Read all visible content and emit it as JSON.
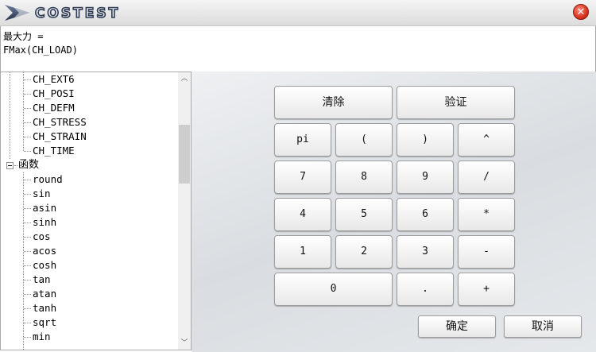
{
  "titlebar": {
    "logo_text": "COSTEST"
  },
  "formula": {
    "line1": "最大力 =",
    "line2": "FMax(CH_LOAD)"
  },
  "tree": {
    "channels": [
      "CH_EXT6",
      "CH_POSI",
      "CH_DEFM",
      "CH_STRESS",
      "CH_STRAIN",
      "CH_TIME"
    ],
    "functions_group": "函数",
    "functions": [
      "round",
      "sin",
      "asin",
      "sinh",
      "cos",
      "acos",
      "cosh",
      "tan",
      "atan",
      "tanh",
      "sqrt",
      "min"
    ]
  },
  "keypad": {
    "clear": "清除",
    "verify": "验证",
    "pi": "pi",
    "lparen": "(",
    "rparen": ")",
    "caret": "^",
    "k7": "7",
    "k8": "8",
    "k9": "9",
    "div": "/",
    "k4": "4",
    "k5": "5",
    "k6": "6",
    "mul": "*",
    "k1": "1",
    "k2": "2",
    "k3": "3",
    "sub": "-",
    "k0": "0",
    "dot": ".",
    "add": "+"
  },
  "dialog": {
    "ok": "确定",
    "cancel": "取消"
  },
  "colors": {
    "close": "#d9341f",
    "panel_bg": "#e2e5e8",
    "logo": "#3a4a63"
  }
}
